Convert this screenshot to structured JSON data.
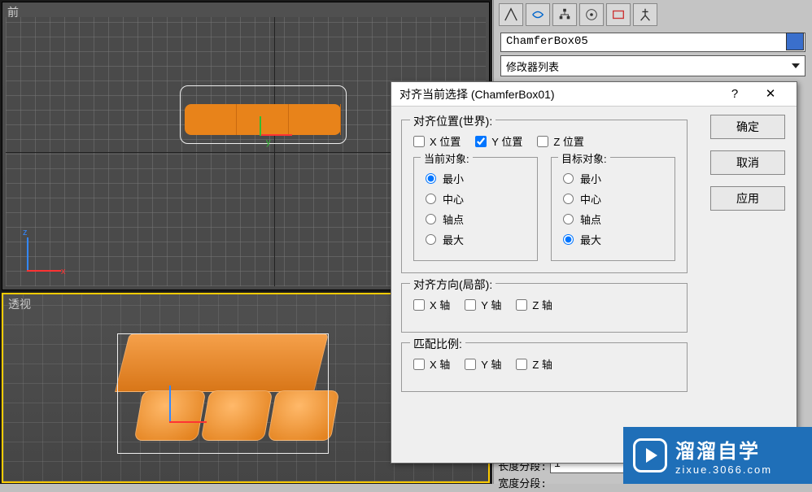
{
  "viewports": {
    "front_label": "前",
    "perspective_label": "透视",
    "axis_x": "x",
    "axis_z": "z",
    "gizmo_y": "y"
  },
  "panel": {
    "object_name": "ChamferBox05",
    "modifier_list": "修改器列表",
    "param_length_seg": "长度分段:",
    "param_length_seg_val": "1",
    "param_width_seg": "宽度分段:"
  },
  "dialog": {
    "title": "对齐当前选择 (ChamferBox01)",
    "help": "?",
    "close": "✕",
    "align_pos_group": "对齐位置(世界):",
    "x_pos": "X 位置",
    "y_pos": "Y 位置",
    "z_pos": "Z 位置",
    "current_obj": "当前对象:",
    "target_obj": "目标对象:",
    "min": "最小",
    "center": "中心",
    "pivot": "轴点",
    "max": "最大",
    "align_orient_group": "对齐方向(局部):",
    "x_axis": "X 轴",
    "y_axis": "Y 轴",
    "z_axis": "Z 轴",
    "match_scale_group": "匹配比例:",
    "ok": "确定",
    "cancel": "取消",
    "apply": "应用"
  },
  "watermark": {
    "brand": "溜溜自学",
    "url": "zixue.3066.com"
  }
}
